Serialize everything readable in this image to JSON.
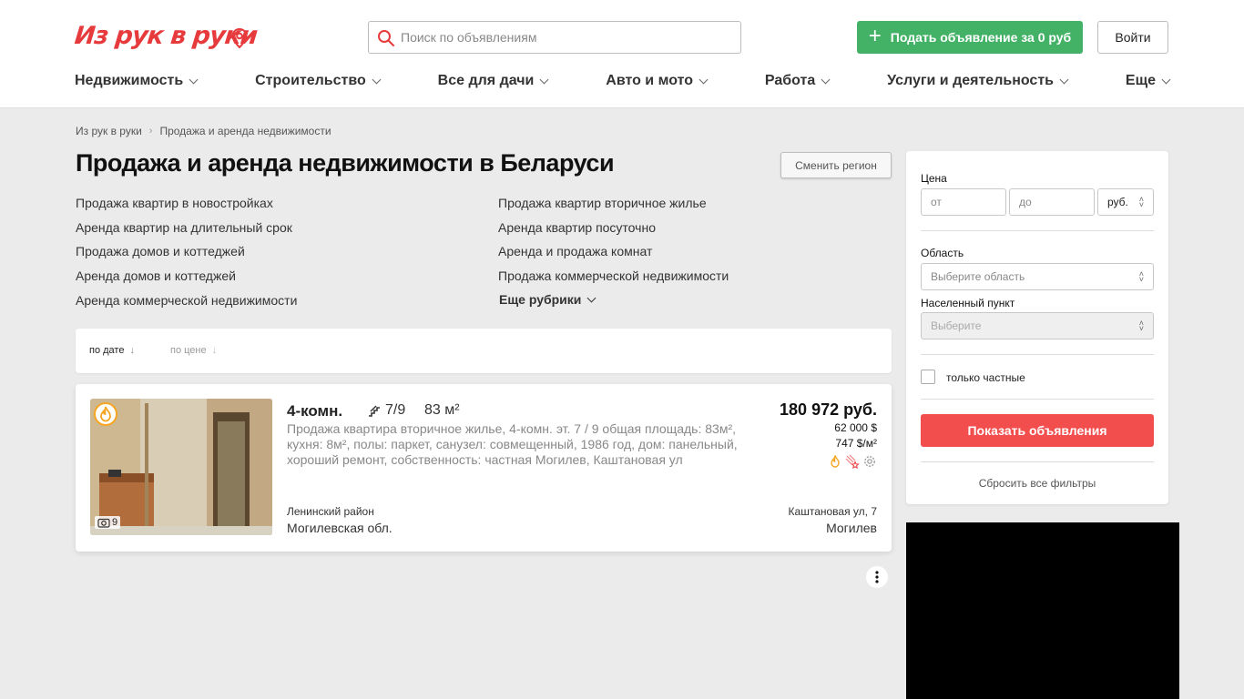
{
  "header": {
    "logo": "Из рук в руки",
    "search_placeholder": "Поиск по объявлениям",
    "post_button": "Подать объявление за 0 руб",
    "login_button": "Войти",
    "nav": [
      "Недвижимость",
      "Строительство",
      "Все для дачи",
      "Авто и мото",
      "Работа",
      "Услуги и деятельность",
      "Еще"
    ]
  },
  "breadcrumbs": [
    "Из рук в руки",
    "Продажа и аренда недвижимости"
  ],
  "page_title": "Продажа и аренда недвижимости в Беларуси",
  "region_button": "Сменить регион",
  "rubrics": {
    "left": [
      "Продажа квартир в новостройках",
      "Аренда квартир на длительный срок",
      "Продажа домов и коттеджей",
      "Аренда домов и коттеджей",
      "Аренда коммерческой недвижимости"
    ],
    "right": [
      "Продажа квартир вторичное жилье",
      "Аренда квартир посуточно",
      "Аренда и продажа комнат",
      "Продажа коммерческой недвижимости"
    ],
    "more": "Еще рубрики"
  },
  "sort": {
    "by_date": "по дате",
    "by_price": "по цене"
  },
  "listing": {
    "photo_count": "9",
    "title": "4-комн.",
    "floor": "7/9",
    "area": "83 м²",
    "description": "Продажа квартира вторичное жилье, 4-комн. эт. 7 / 9 общая площадь: 83м², кухня: 8м², полы: паркет, санузел: совмещенный, 1986 год, дом: панельный, хороший ремонт, собственность: частная Могилев, Каштановая ул",
    "price": "180 972 руб.",
    "price_usd": "62 000 $",
    "price_per_m2": "747 $/м²",
    "district": "Ленинский район",
    "oblast": "Могилевская обл.",
    "street": "Каштановая ул, 7",
    "city": "Могилев"
  },
  "filters": {
    "price_label": "Цена",
    "price_from": "от",
    "price_to": "до",
    "currency": "руб.",
    "region_label": "Область",
    "region_placeholder": "Выберите область",
    "locality_label": "Населенный пункт",
    "locality_placeholder": "Выберите",
    "private_only": "только частные",
    "show_button": "Показать объявления",
    "reset": "Сбросить все фильтры"
  },
  "colors": {
    "brand_red": "#e73a3d",
    "post_green": "#43b266",
    "show_red": "#f34e4e",
    "highlight_orange": "#f5a623"
  }
}
